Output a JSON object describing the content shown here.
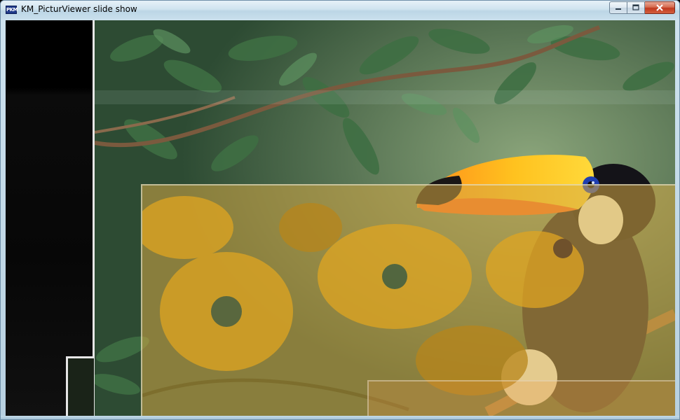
{
  "window": {
    "title": "KM_PicturViewer slide show",
    "icon_label": "PKM",
    "accent_color": "#c0391e",
    "frame_color": "#cfe3ef"
  },
  "caption_buttons": {
    "minimize_icon": "minimize-icon",
    "maximize_icon": "maximize-icon",
    "close_icon": "close-icon"
  },
  "slideshow": {
    "current_image_subject": "toucan-on-branch",
    "blending_image_subject": "yellow-flowers",
    "background_color": "#000000"
  }
}
